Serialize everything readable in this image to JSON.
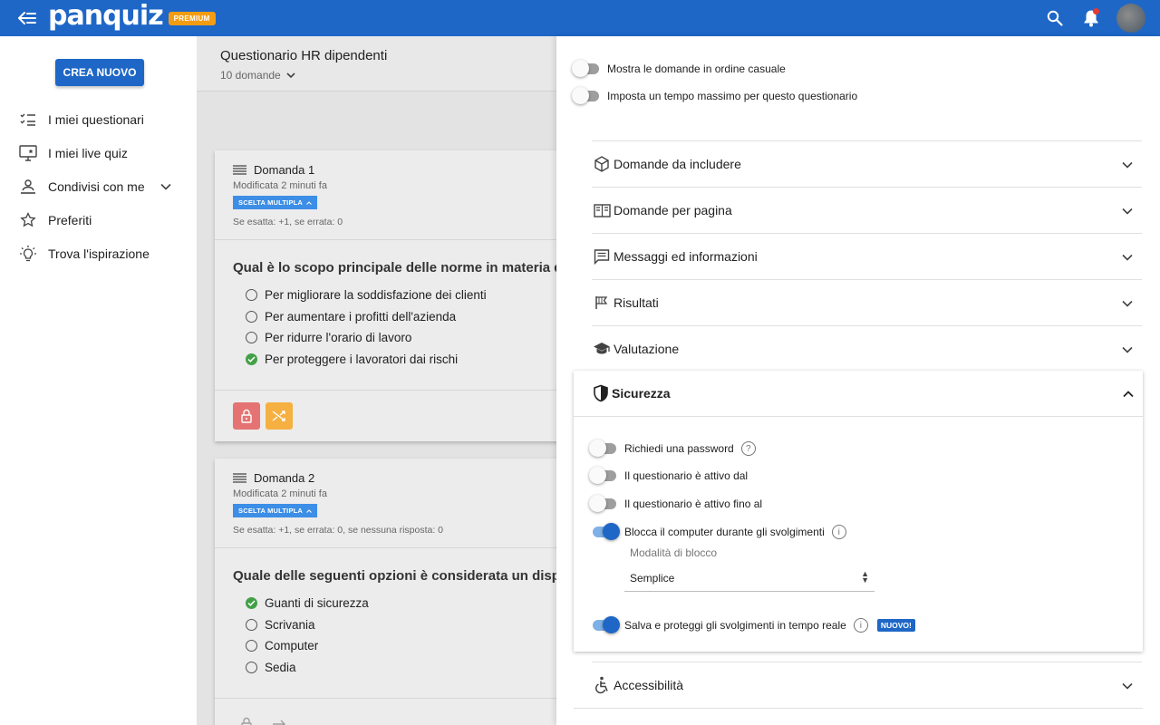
{
  "app": {
    "logo": "panquiz",
    "plan_badge": "PREMIUM"
  },
  "sidebar": {
    "new_button": "CREA NUOVO",
    "items": [
      {
        "label": "I miei questionari",
        "icon": "checklist-icon"
      },
      {
        "label": "I miei live quiz",
        "icon": "monitor-star-icon"
      },
      {
        "label": "Condivisi con me",
        "icon": "shared-user-icon"
      },
      {
        "label": "Preferiti",
        "icon": "star-outline-icon"
      },
      {
        "label": "Trova l'ispirazione",
        "icon": "lightbulb-icon"
      }
    ]
  },
  "quiz": {
    "title": "Questionario HR dipendenti",
    "count": "10 domande",
    "questions": [
      {
        "name": "Domanda 1",
        "modified": "Modificata 2 minuti fa",
        "type_badge": "SCELTA MULTIPLA",
        "score": "Se esatta: +1, se errata: 0",
        "text": "Qual è lo scopo principale delle norme in materia di sa",
        "options": [
          {
            "text": "Per migliorare la soddisfazione dei clienti",
            "correct": false
          },
          {
            "text": "Per aumentare i profitti dell'azienda",
            "correct": false
          },
          {
            "text": "Per ridurre l'orario di lavoro",
            "correct": false
          },
          {
            "text": "Per proteggere i lavoratori dai rischi",
            "correct": true
          }
        ]
      },
      {
        "name": "Domanda 2",
        "modified": "Modificata 2 minuti fa",
        "type_badge": "SCELTA MULTIPLA",
        "score": "Se esatta: +1, se errata: 0, se nessuna risposta: 0",
        "text": "Quale delle seguenti opzioni è considerata un disposi",
        "options": [
          {
            "text": "Guanti di sicurezza",
            "correct": true
          },
          {
            "text": "Scrivania",
            "correct": false
          },
          {
            "text": "Computer",
            "correct": false
          },
          {
            "text": "Sedia",
            "correct": false
          }
        ]
      }
    ]
  },
  "settings": {
    "top_toggles": [
      {
        "label": "Mostra le domande in ordine casuale",
        "on": false
      },
      {
        "label": "Imposta un tempo massimo per questo questionario",
        "on": false
      }
    ],
    "sections": [
      {
        "label": "Domande da includere",
        "icon": "cube-icon"
      },
      {
        "label": "Domande per pagina",
        "icon": "book-open-icon"
      },
      {
        "label": "Messaggi ed informazioni",
        "icon": "message-icon"
      },
      {
        "label": "Risultati",
        "icon": "flag-icon"
      },
      {
        "label": "Valutazione",
        "icon": "graduation-cap-icon"
      }
    ],
    "security": {
      "title": "Sicurezza",
      "password": "Richiedi una password",
      "active_from": "Il questionario è attivo dal",
      "active_until": "Il questionario è attivo fino al",
      "lock_computer": "Blocca il computer durante gli svolgimenti",
      "mode_label": "Modalità di blocco",
      "mode_value": "Semplice",
      "save_protect": "Salva e proteggi gli svolgimenti in tempo reale",
      "new_badge": "NUOVO!"
    },
    "accessibility": "Accessibilità"
  },
  "colors": {
    "brand": "#1e67c7",
    "premium": "#f39c12",
    "correct": "#43a047",
    "lock_button": "#e57373",
    "shuffle_button": "#f5b041"
  }
}
